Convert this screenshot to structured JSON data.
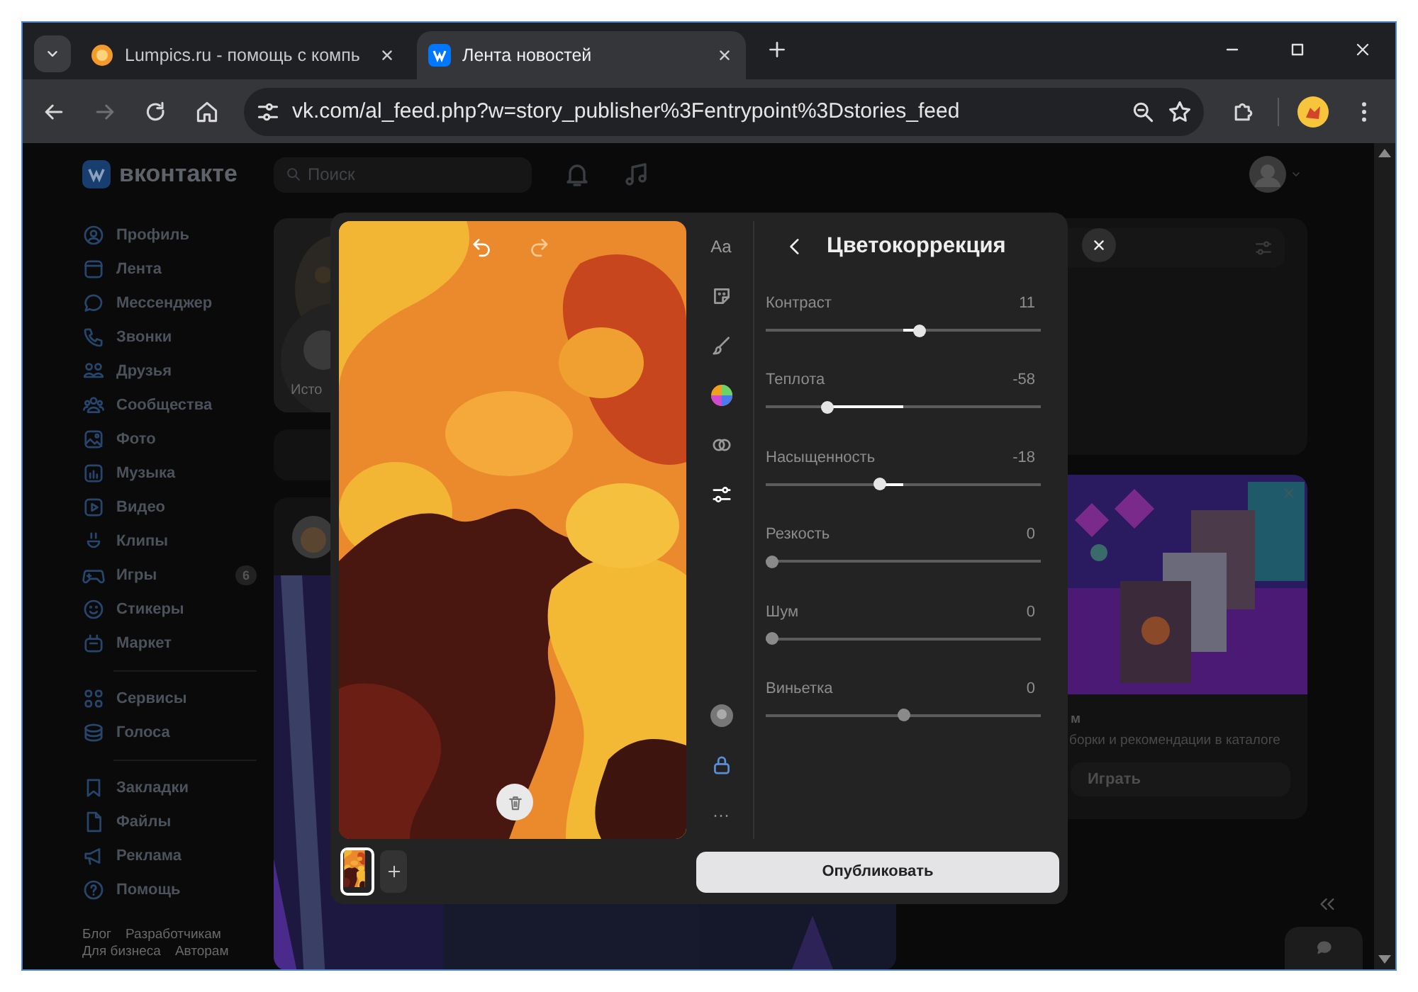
{
  "browser": {
    "tabs": [
      {
        "title": "Lumpics.ru - помощь с компь",
        "selected": false
      },
      {
        "title": "Лента новостей",
        "selected": true
      }
    ],
    "address": "vk.com/al_feed.php?w=story_publisher%3Fentrypoint%3Dstories_feed"
  },
  "vk": {
    "logo": "вконтакте",
    "search": {
      "placeholder": "Поиск"
    },
    "sidebar": {
      "groups": [
        [
          {
            "label": "Профиль"
          },
          {
            "label": "Лента"
          },
          {
            "label": "Мессенджер"
          },
          {
            "label": "Звонки"
          },
          {
            "label": "Друзья"
          },
          {
            "label": "Сообщества"
          },
          {
            "label": "Фото"
          },
          {
            "label": "Музыка"
          },
          {
            "label": "Видео"
          },
          {
            "label": "Клипы"
          },
          {
            "label": "Игры",
            "badge": "6"
          },
          {
            "label": "Стикеры"
          },
          {
            "label": "Маркет"
          }
        ],
        [
          {
            "label": "Сервисы"
          },
          {
            "label": "Голоса"
          }
        ],
        [
          {
            "label": "Закладки"
          },
          {
            "label": "Файлы"
          },
          {
            "label": "Реклама"
          },
          {
            "label": "Помощь"
          }
        ]
      ],
      "footer": [
        "Блог",
        "Разработчикам",
        "Для бизнеса",
        "Авторам"
      ]
    },
    "story": {
      "caption": "Исто"
    },
    "games": {
      "title": "м",
      "text": "борки и рекомендации в каталоге",
      "button": "Играть"
    }
  },
  "editor": {
    "tools": [
      {
        "label": "Aa",
        "selected": false
      },
      {
        "selected": false
      },
      {
        "selected": false
      },
      {
        "selected": false
      },
      {
        "selected": false
      },
      {
        "selected": true
      }
    ],
    "more": "···",
    "title": "Цветокоррекция",
    "sliders": [
      {
        "name": "Контраст",
        "reading": "11",
        "level": 0.56,
        "kind": "bipolar",
        "modified": true
      },
      {
        "name": "Теплота",
        "reading": "-58",
        "level": 0.21,
        "kind": "bipolar",
        "modified": true
      },
      {
        "name": "Насыщенность",
        "reading": "-18",
        "level": 0.41,
        "kind": "bipolar",
        "modified": true
      },
      {
        "name": "Резкость",
        "reading": "0",
        "level": 0,
        "kind": "unipolar",
        "modified": false
      },
      {
        "name": "Шум",
        "reading": "0",
        "level": 0,
        "kind": "unipolar",
        "modified": false
      },
      {
        "name": "Виньетка",
        "reading": "0",
        "level": 0.5,
        "kind": "bipolar",
        "modified": false
      }
    ],
    "publish": "Опубликовать"
  }
}
